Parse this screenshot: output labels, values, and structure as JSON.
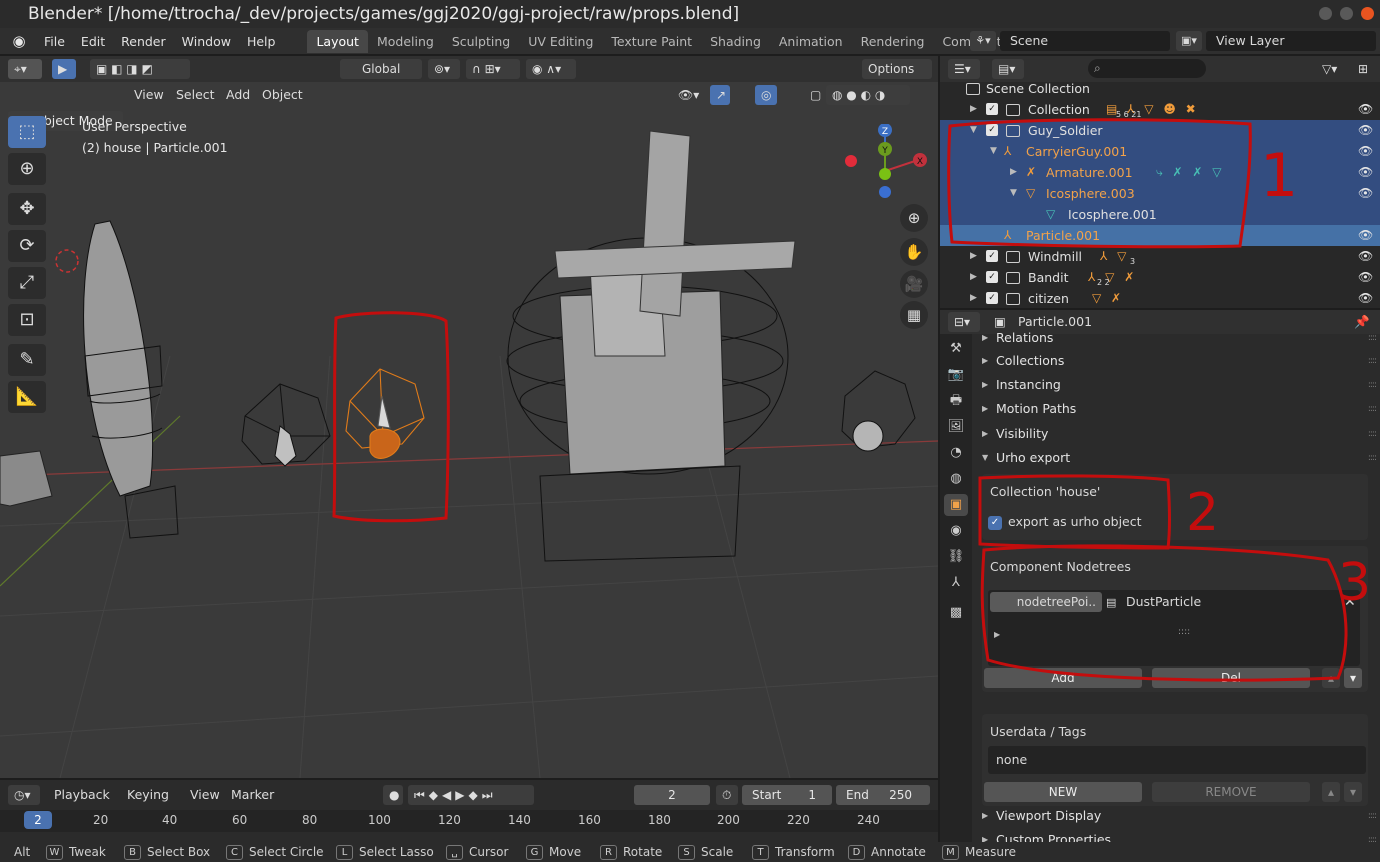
{
  "window": {
    "title": "Blender* [/home/ttrocha/_dev/projects/games/ggj2020/ggj-project/raw/props.blend]"
  },
  "menu": {
    "items": [
      "File",
      "Edit",
      "Render",
      "Window",
      "Help"
    ]
  },
  "workspaces": [
    "Layout",
    "Modeling",
    "Sculpting",
    "UV Editing",
    "Texture Paint",
    "Shading",
    "Animation",
    "Rendering",
    "Compositing"
  ],
  "scene": {
    "name": "Scene",
    "view_layer": "View Layer"
  },
  "viewport": {
    "transform_orientation": "Global",
    "options_label": "Options",
    "mode": "Object Mode",
    "header_menus": [
      "View",
      "Select",
      "Add",
      "Object"
    ],
    "info_line1": "User Perspective",
    "info_line2": "(2) house | Particle.001",
    "gizmo_axes": {
      "z": "Z",
      "y": "Y",
      "x": "X"
    }
  },
  "outliner": {
    "rows": [
      {
        "name": "Scene Collection"
      },
      {
        "name": "Collection",
        "badges": "5  6  21"
      },
      {
        "name": "Guy_Soldier"
      },
      {
        "name": "CarryierGuy.001"
      },
      {
        "name": "Armature.001"
      },
      {
        "name": "Icosphere.003"
      },
      {
        "name": "Icosphere.001"
      },
      {
        "name": "Particle.001"
      },
      {
        "name": "Windmill",
        "badges": "3"
      },
      {
        "name": "Bandit",
        "badges": "2  2"
      },
      {
        "name": "citizen"
      }
    ]
  },
  "properties": {
    "object_name": "Particle.001",
    "panels": [
      "Relations",
      "Collections",
      "Instancing",
      "Motion Paths",
      "Visibility",
      "Urho export"
    ],
    "collection_label": "Collection 'house'",
    "export_checkbox": "export as urho object",
    "component_nodetrees": "Component Nodetrees",
    "nodetree_left": "nodetreePoi..",
    "nodetree_right": "DustParticle",
    "add_label": "Add",
    "del_label": "Del",
    "userdata_label": "Userdata / Tags",
    "userdata_value": "none",
    "new_label": "NEW",
    "remove_label": "REMOVE",
    "bottom_panels": [
      "Viewport Display",
      "Custom Properties"
    ]
  },
  "timeline": {
    "menus": [
      "Playback",
      "Keying",
      "View",
      "Marker"
    ],
    "current_frame": "2",
    "start_label": "Start",
    "start_value": "1",
    "end_label": "End",
    "end_value": "250",
    "ruler_ticks": [
      "20",
      "40",
      "60",
      "80",
      "100",
      "120",
      "140",
      "160",
      "180",
      "200",
      "220",
      "240"
    ],
    "playhead": "2"
  },
  "annotations": {
    "one": "1",
    "two": "2",
    "three": "3"
  },
  "statusbar": {
    "items": [
      {
        "key": "",
        "label": "Alt"
      },
      {
        "key": "W",
        "label": "Tweak"
      },
      {
        "key": "B",
        "label": "Select Box"
      },
      {
        "key": "C",
        "label": "Select Circle"
      },
      {
        "key": "L",
        "label": "Select Lasso"
      },
      {
        "key": "␣",
        "label": "Cursor"
      },
      {
        "key": "G",
        "label": "Move"
      },
      {
        "key": "R",
        "label": "Rotate"
      },
      {
        "key": "S",
        "label": "Scale"
      },
      {
        "key": "T",
        "label": "Transform"
      },
      {
        "key": "D",
        "label": "Annotate"
      },
      {
        "key": "M",
        "label": "Measure"
      }
    ]
  },
  "colors": {
    "accent": "#4a72b0",
    "selection": "#334d80",
    "object_orange": "#f2a24a",
    "annotation_red": "#c40d0d"
  }
}
